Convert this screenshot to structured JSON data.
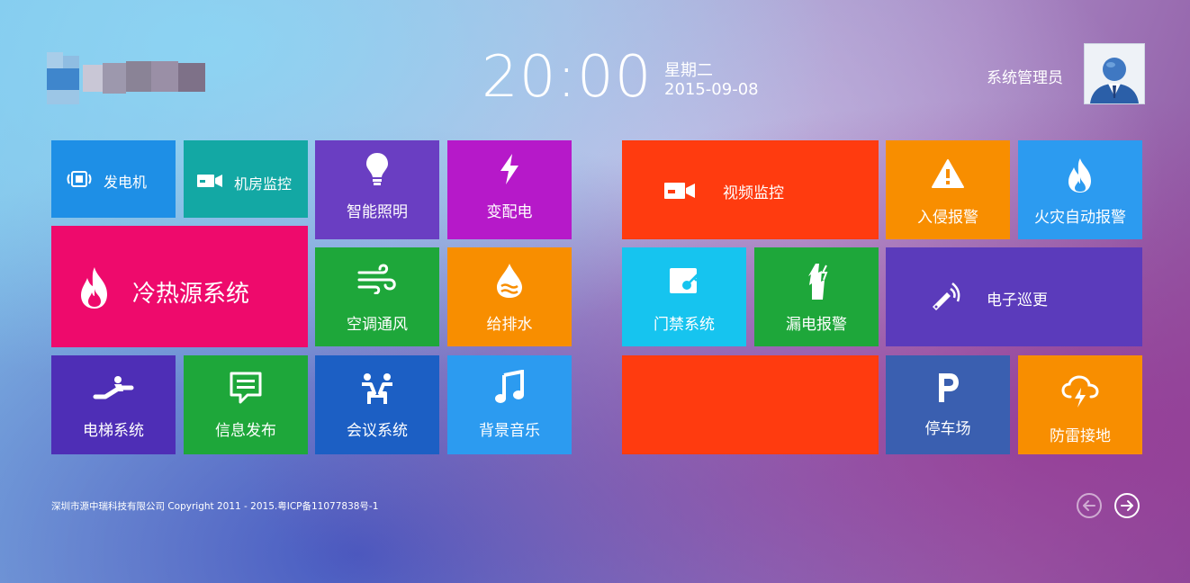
{
  "header": {
    "time": "20:00",
    "weekday": "星期二",
    "date": "2015-09-08",
    "user_name": "系统管理员"
  },
  "tiles": {
    "generator": "发电机",
    "room_monitor": "机房监控",
    "smart_lighting": "智能照明",
    "power_distribution": "变配电",
    "heating_cooling": "冷热源系统",
    "hvac": "空调通风",
    "water_supply": "给排水",
    "elevator": "电梯系统",
    "info_publish": "信息发布",
    "conference": "会议系统",
    "bg_music": "背景音乐",
    "video_monitor": "视频监控",
    "intrusion_alarm": "入侵报警",
    "fire_alarm": "火灾自动报警",
    "access_control": "门禁系统",
    "leak_alarm": "漏电报警",
    "patrol": "电子巡更",
    "parking": "停车场",
    "lightning": "防雷接地"
  },
  "colors": {
    "blue": "#1e8fe6",
    "teal": "#13a8a4",
    "purple": "#6a3ec2",
    "magenta": "#b619c9",
    "pink": "#ee0a6c",
    "green": "#1ea73a",
    "orange": "#f88e00",
    "indigo": "#4e2eb6",
    "royal_blue": "#1c5fc4",
    "sky": "#2c9bf0",
    "red_orange": "#ff3b0f",
    "cyan": "#16c4ef",
    "dark_blue": "#3a5fb0",
    "violet": "#5b3bbb"
  },
  "footer": {
    "copyright": "深圳市源中瑞科技有限公司 Copyright 2011 - 2015.粤ICP备11077838号-1"
  }
}
